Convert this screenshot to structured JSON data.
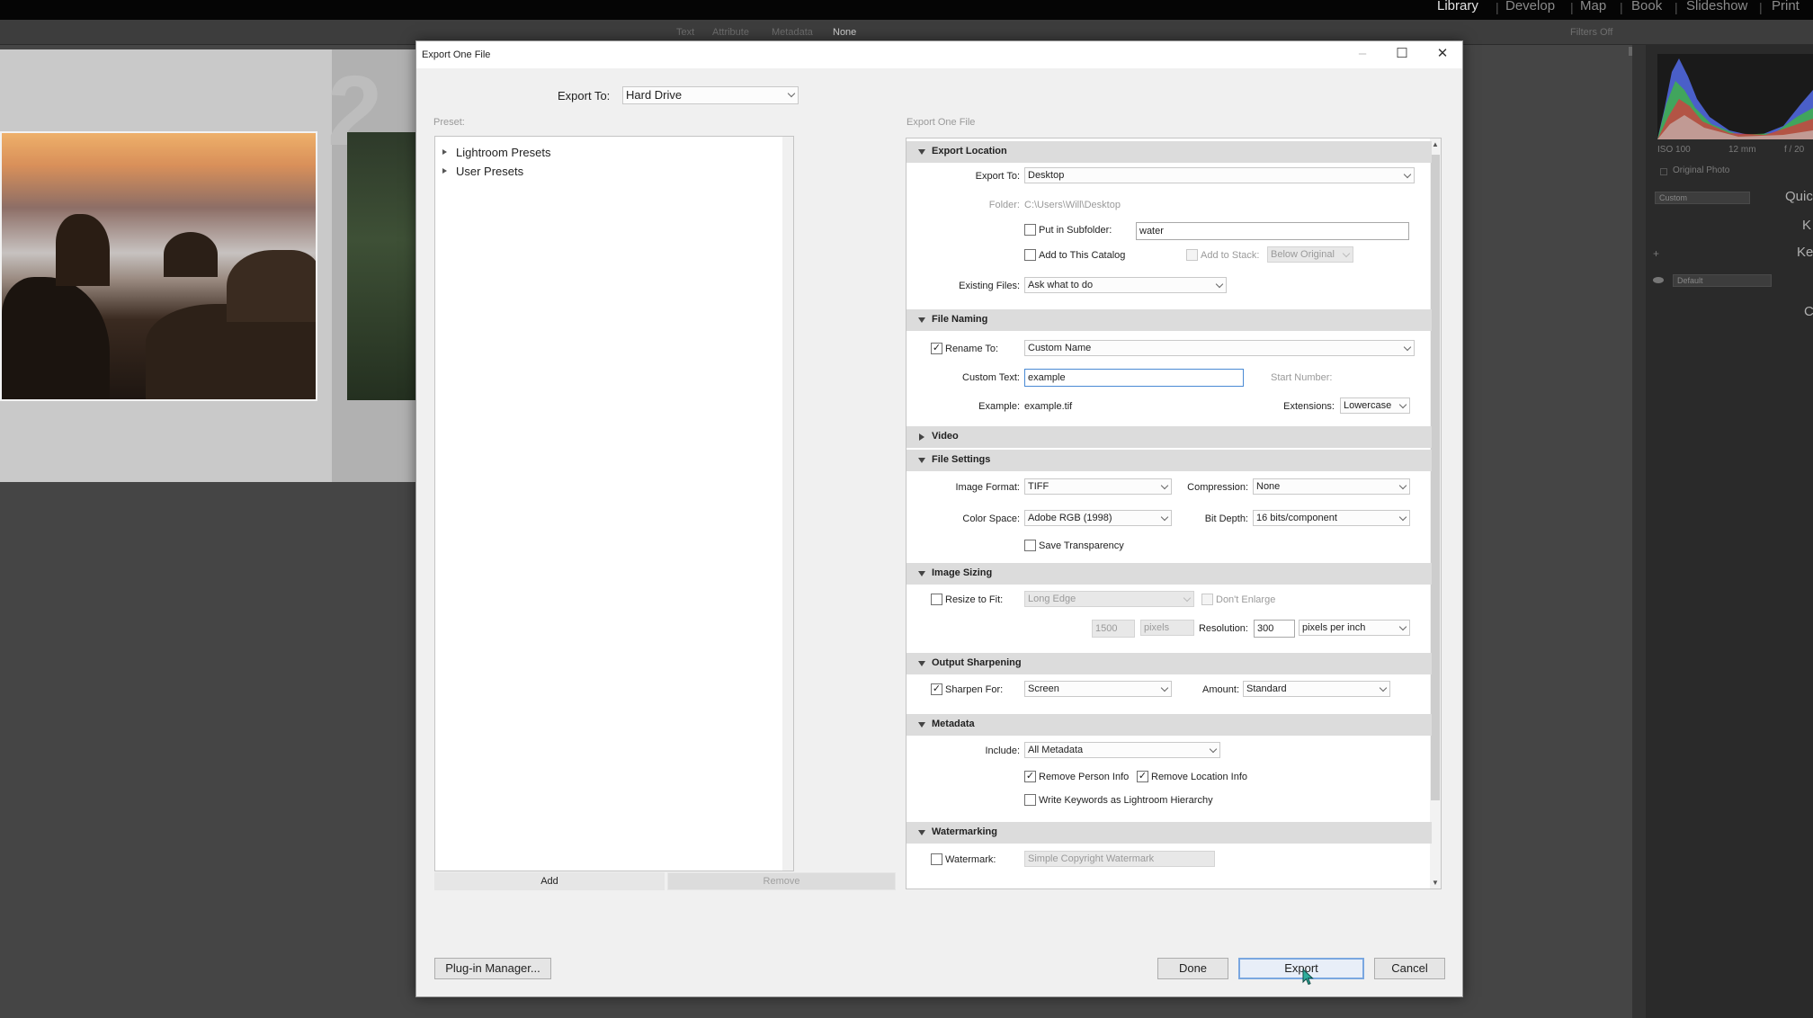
{
  "lightroom": {
    "modules": [
      "Library",
      "Develop",
      "Map",
      "Book",
      "Slideshow",
      "Print"
    ],
    "active_module": "Library",
    "filter_bar": [
      "Text",
      "Attribute",
      "Metadata",
      "None"
    ],
    "filters_off": "Filters Off",
    "grid_cell_number": "2",
    "right_panel": {
      "histogram_info": [
        "ISO 100",
        "12 mm",
        "f / 20"
      ],
      "original_photo": "Original Photo",
      "custom_select": "Custom",
      "quick_label": "Quic",
      "k_label": "K",
      "key_label": "Key",
      "c_label": "C",
      "default_select": "Default"
    }
  },
  "dialog": {
    "title": "Export One File",
    "export_to_label": "Export To:",
    "export_to_value": "Hard Drive",
    "preset_label": "Preset:",
    "presets": [
      "Lightroom Presets",
      "User Presets"
    ],
    "add_button": "Add",
    "remove_button": "Remove",
    "settings_label": "Export One File",
    "plugin_manager": "Plug-in Manager...",
    "done": "Done",
    "export": "Export",
    "cancel": "Cancel"
  },
  "export_location": {
    "title": "Export Location",
    "export_to_label": "Export To:",
    "export_to_value": "Desktop",
    "folder_label": "Folder:",
    "folder_value": "C:\\Users\\Will\\Desktop",
    "subfolder_label": "Put in Subfolder:",
    "subfolder_checked": false,
    "subfolder_value": "water",
    "add_catalog_label": "Add to This Catalog",
    "add_catalog_checked": false,
    "add_stack_label": "Add to Stack:",
    "add_stack_value": "Below Original",
    "existing_files_label": "Existing Files:",
    "existing_files_value": "Ask what to do"
  },
  "file_naming": {
    "title": "File Naming",
    "rename_label": "Rename To:",
    "rename_checked": true,
    "rename_value": "Custom Name",
    "custom_text_label": "Custom Text:",
    "custom_text_value": "example",
    "start_number_label": "Start Number:",
    "example_label": "Example:",
    "example_value": "example.tif",
    "extensions_label": "Extensions:",
    "extensions_value": "Lowercase"
  },
  "video": {
    "title": "Video"
  },
  "file_settings": {
    "title": "File Settings",
    "image_format_label": "Image Format:",
    "image_format_value": "TIFF",
    "compression_label": "Compression:",
    "compression_value": "None",
    "color_space_label": "Color Space:",
    "color_space_value": "Adobe RGB (1998)",
    "bit_depth_label": "Bit Depth:",
    "bit_depth_value": "16 bits/component",
    "save_transparency_label": "Save Transparency",
    "save_transparency_checked": false
  },
  "image_sizing": {
    "title": "Image Sizing",
    "resize_label": "Resize to Fit:",
    "resize_checked": false,
    "resize_value": "Long Edge",
    "dont_enlarge_label": "Don't Enlarge",
    "size_value": "1500",
    "size_unit": "pixels",
    "resolution_label": "Resolution:",
    "resolution_value": "300",
    "resolution_unit": "pixels per inch"
  },
  "output_sharpening": {
    "title": "Output Sharpening",
    "sharpen_label": "Sharpen For:",
    "sharpen_checked": true,
    "sharpen_value": "Screen",
    "amount_label": "Amount:",
    "amount_value": "Standard"
  },
  "metadata": {
    "title": "Metadata",
    "include_label": "Include:",
    "include_value": "All Metadata",
    "remove_person_label": "Remove Person Info",
    "remove_person_checked": true,
    "remove_location_label": "Remove Location Info",
    "remove_location_checked": true,
    "write_keywords_label": "Write Keywords as Lightroom Hierarchy",
    "write_keywords_checked": false
  },
  "watermarking": {
    "title": "Watermarking",
    "watermark_label": "Watermark:",
    "watermark_checked": false,
    "watermark_value": "Simple Copyright Watermark"
  },
  "checkmark": "✓"
}
